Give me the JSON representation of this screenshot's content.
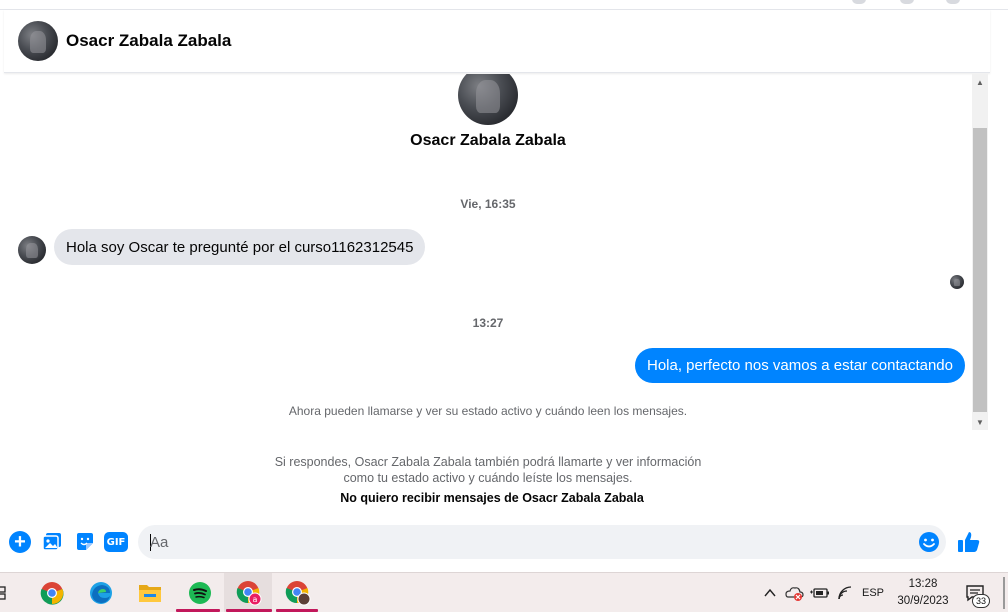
{
  "header": {
    "contact_name": "Osacr Zabala Zabala"
  },
  "conversation": {
    "profile_name": "Osacr Zabala Zabala",
    "timestamp_1": "Vie, 16:35",
    "incoming_message": "Hola soy Oscar te pregunté por el curso1162312545",
    "timestamp_2": "13:27",
    "outgoing_message": "Hola, perfecto nos vamos a estar contactando",
    "call_notice": "Ahora pueden llamarse y ver su estado activo y cuándo leen los mensajes.",
    "reply_info_line1": "Si respondes, Osacr Zabala Zabala también podrá llamarte y ver información",
    "reply_info_line2": "como tu estado activo y cuándo leíste los mensajes.",
    "block_link": "No quiero recibir mensajes de Osacr Zabala Zabala"
  },
  "composer": {
    "placeholder": "Aa",
    "gif_label": "GIF",
    "plus_label": "+"
  },
  "taskbar": {
    "language": "ESP",
    "time": "13:28",
    "date": "30/9/2023",
    "notification_count": "33"
  },
  "colors": {
    "messenger_blue": "#0084ff",
    "incoming_bubble": "#e4e6eb",
    "taskbar_bg": "#f3ecec"
  }
}
